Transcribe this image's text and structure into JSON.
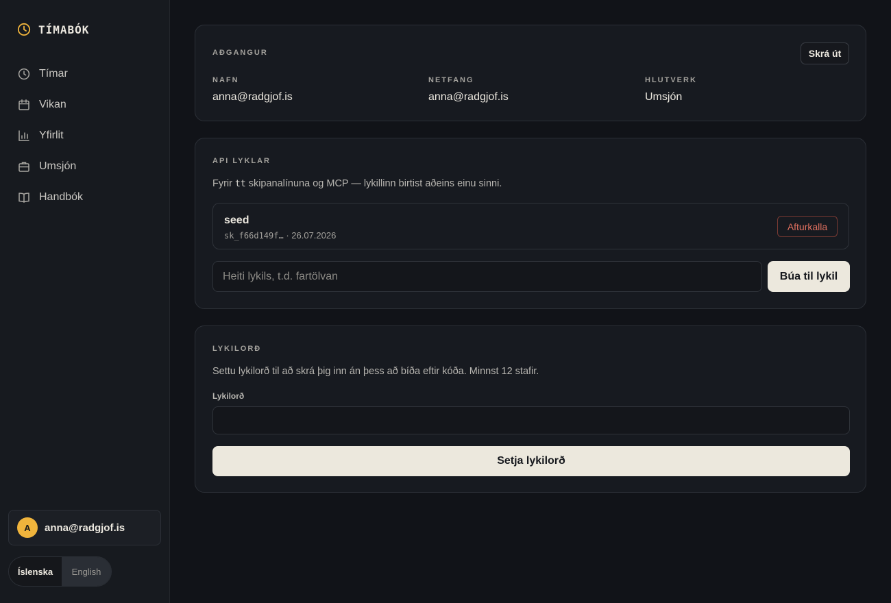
{
  "app": {
    "name": "TÍMABÓK",
    "brand_icon": "clock-icon",
    "accent": "#f0b43c"
  },
  "sidebar": {
    "items": [
      {
        "label": "Tímar",
        "icon": "clock-icon"
      },
      {
        "label": "Vikan",
        "icon": "calendar-icon"
      },
      {
        "label": "Yfirlit",
        "icon": "bar-chart-icon"
      },
      {
        "label": "Umsjón",
        "icon": "briefcase-icon"
      },
      {
        "label": "Handbók",
        "icon": "book-icon"
      }
    ],
    "user": {
      "initial": "A",
      "email": "anna@radgjof.is"
    },
    "language": {
      "options": [
        "Íslenska",
        "English"
      ],
      "selected": "Íslenska"
    }
  },
  "account": {
    "title": "AÐGANGUR",
    "logout_label": "Skrá út",
    "fields": [
      {
        "label": "NAFN",
        "value": "anna@radgjof.is"
      },
      {
        "label": "NETFANG",
        "value": "anna@radgjof.is"
      },
      {
        "label": "HLUTVERK",
        "value": "Umsjón"
      }
    ]
  },
  "api_keys": {
    "title": "API LYKLAR",
    "description_prefix": "Fyrir ",
    "description_code": "tt",
    "description_suffix": " skipanalínuna og MCP — lykillinn birtist aðeins einu sinni.",
    "keys": [
      {
        "name": "seed",
        "prefix": "sk_f66d149f…",
        "date": "· 26.07.2026",
        "revoke_label": "Afturkalla"
      }
    ],
    "new_key_placeholder": "Heiti lykils, t.d. fartölvan",
    "create_label": "Búa til lykil"
  },
  "password": {
    "title": "LYKILORÐ",
    "description": "Settu lykilorð til að skrá þig inn án þess að bíða eftir kóða. Minnst 12 stafir.",
    "field_label": "Lykilorð",
    "value": "",
    "submit_label": "Setja lykilorð"
  }
}
